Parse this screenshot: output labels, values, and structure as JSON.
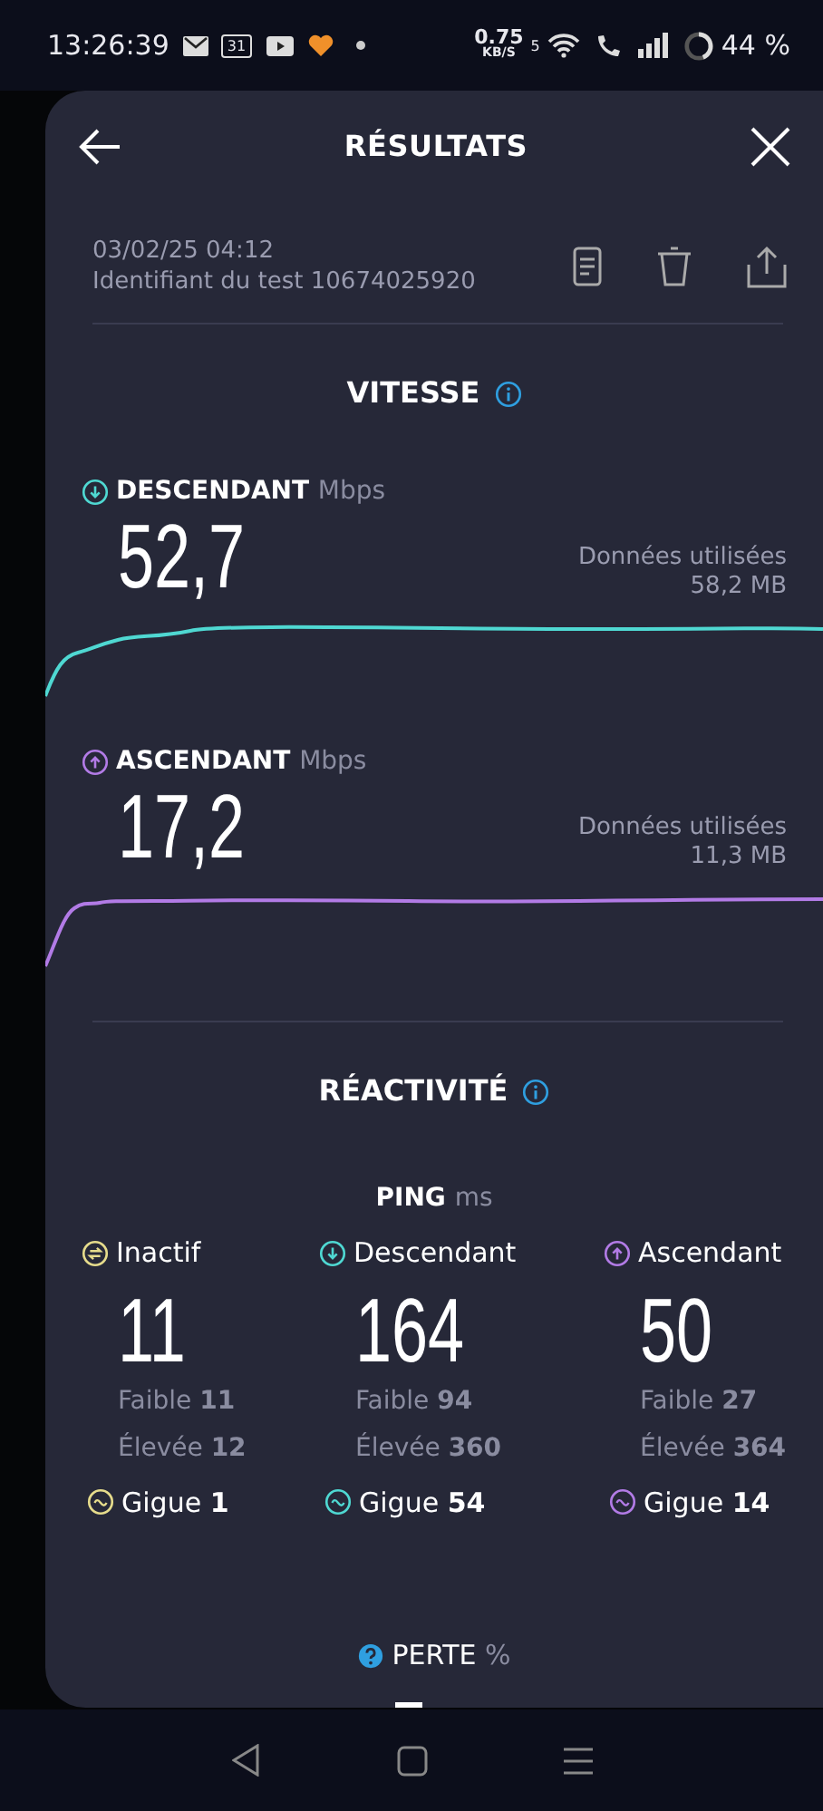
{
  "status_bar": {
    "time": "13:26:39",
    "calendar_day": "31",
    "net_speed": "0.75",
    "net_unit": "KB/S",
    "wifi_band": "5",
    "battery": "44 %"
  },
  "header": {
    "title": "RÉSULTATS"
  },
  "test": {
    "date": "03/02/25 04:12",
    "id_text": "Identifiant du test 10674025920"
  },
  "speed": {
    "title": "VITESSE",
    "metrics": [
      {
        "kind": "download",
        "label": "DESCENDANT",
        "unit": "Mbps",
        "value": "52,7",
        "data_label": "Données utilisées",
        "data_value": "58,2 MB",
        "color": "#4fd8d2"
      },
      {
        "kind": "upload",
        "label": "ASCENDANT",
        "unit": "Mbps",
        "value": "17,2",
        "data_label": "Données utilisées",
        "data_value": "11,3 MB",
        "color": "#b27be6"
      }
    ]
  },
  "responsiveness": {
    "title": "RÉACTIVITÉ",
    "ping_label": "PING",
    "ping_unit": "ms",
    "columns": [
      {
        "kind": "idle",
        "label": "Inactif",
        "value": "11",
        "low_label": "Faible",
        "low": "11",
        "high_label": "Élevée",
        "high": "12",
        "jitter_label": "Gigue",
        "jitter": "1",
        "color": "#e6dc8c"
      },
      {
        "kind": "download",
        "label": "Descendant",
        "value": "164",
        "low_label": "Faible",
        "low": "94",
        "high_label": "Élevée",
        "high": "360",
        "jitter_label": "Gigue",
        "jitter": "54",
        "color": "#4fd8d2"
      },
      {
        "kind": "upload",
        "label": "Ascendant",
        "value": "50",
        "low_label": "Faible",
        "low": "27",
        "high_label": "Élevée",
        "high": "364",
        "jitter_label": "Gigue",
        "jitter": "14",
        "color": "#b27be6"
      }
    ]
  },
  "loss": {
    "label": "PERTE",
    "unit": "%"
  }
}
